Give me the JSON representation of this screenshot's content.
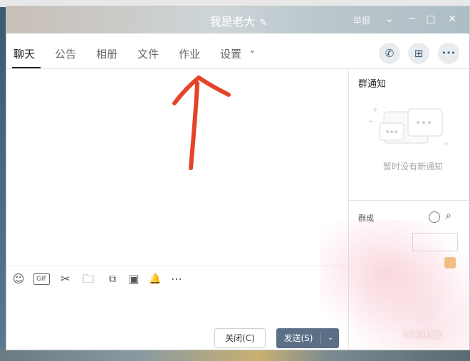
{
  "window": {
    "title": "我是老大",
    "title_edit_icon": "✎",
    "report_label": "举报",
    "collapse_icon": "chevron-down-icon",
    "buttons": {
      "minimize": "─",
      "maximize": "□",
      "close": "✕"
    }
  },
  "tabs": [
    {
      "label": "聊天",
      "active": true
    },
    {
      "label": "公告"
    },
    {
      "label": "相册"
    },
    {
      "label": "文件"
    },
    {
      "label": "作业"
    },
    {
      "label": "设置"
    }
  ],
  "tabs_dropdown": "⌄",
  "header_actions": {
    "phone": "✆",
    "add": "⊞",
    "more": "•••"
  },
  "notice": {
    "title": "群通知",
    "empty_text": "暂时没有新通知"
  },
  "members": {
    "title": "群成"
  },
  "toolbar": {
    "emoji": "☺",
    "gif": "GIF",
    "scissors": "✂",
    "folder": "🗀",
    "image": "▣",
    "bell": "🔔",
    "more": "⋯"
  },
  "buttons": {
    "close_label": "关闭(C)",
    "send_label": "发送(S)",
    "send_dropdown": "⌄"
  },
  "watermark": "S优质精选",
  "colors": {
    "accent": "#5b6f86",
    "arrow": "#e5432a"
  }
}
